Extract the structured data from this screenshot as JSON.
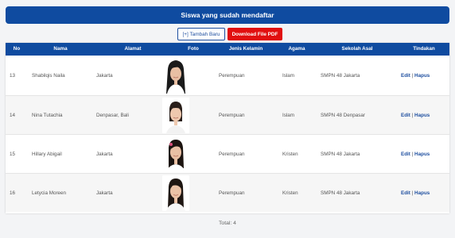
{
  "header": {
    "title": "Siswa yang sudah mendaftar"
  },
  "toolbar": {
    "add_label": "[+] Tambah Baru",
    "pdf_label": "Download File PDF"
  },
  "table": {
    "columns": [
      "No",
      "Nama",
      "Alamat",
      "Foto",
      "Jenis Kelamin",
      "Agama",
      "Sekolah Asal",
      "Tindakan"
    ],
    "rows": [
      {
        "no": "13",
        "nama": "Shabilqis Naila",
        "alamat": "Jakarta",
        "jenis_kelamin": "Perempuan",
        "agama": "Islam",
        "sekolah_asal": "SMPN 48 Jakarta",
        "edit": "Edit",
        "sep": "|",
        "hapus": "Hapus"
      },
      {
        "no": "14",
        "nama": "Nina Tutachia",
        "alamat": "Denpasar, Bali",
        "jenis_kelamin": "Perempuan",
        "agama": "Islam",
        "sekolah_asal": "SMPN 48 Denpasar",
        "edit": "Edit",
        "sep": "|",
        "hapus": "Hapus"
      },
      {
        "no": "15",
        "nama": "Hillary Abigail",
        "alamat": "Jakarta",
        "jenis_kelamin": "Perempuan",
        "agama": "Kristen",
        "sekolah_asal": "SMPN 48 Jakarta",
        "edit": "Edit",
        "sep": "|",
        "hapus": "Hapus"
      },
      {
        "no": "16",
        "nama": "Letycia Moreen",
        "alamat": "Jakarta",
        "jenis_kelamin": "Perempuan",
        "agama": "Kristen",
        "sekolah_asal": "SMPN 48 Jakarta",
        "edit": "Edit",
        "sep": "|",
        "hapus": "Hapus"
      }
    ]
  },
  "footer": {
    "total": "Total: 4"
  },
  "colors": {
    "primary": "#0f4ba0",
    "danger": "#e10f0f",
    "link": "#1d4e9f"
  }
}
